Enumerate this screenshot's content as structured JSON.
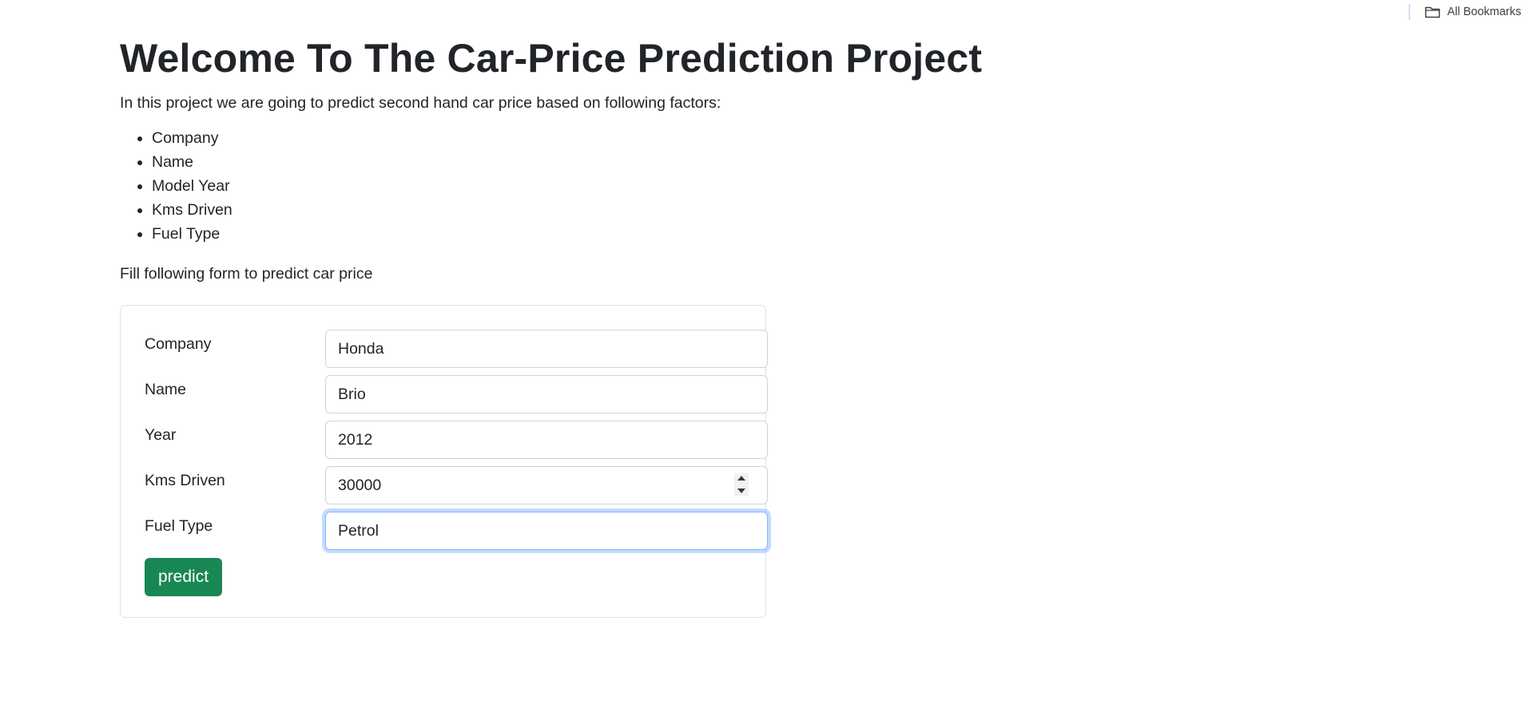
{
  "bookmarks": {
    "all_bookmarks_label": "All Bookmarks"
  },
  "page": {
    "title": "Welcome To The Car-Price Prediction Project",
    "intro": "In this project we are going to predict second hand car price based on following factors:",
    "factors": [
      "Company",
      "Name",
      "Model Year",
      "Kms Driven",
      "Fuel Type"
    ],
    "fill_note": "Fill following form to predict car price"
  },
  "form": {
    "company_label": "Company",
    "company_value": "Honda",
    "name_label": "Name",
    "name_value": "Brio",
    "year_label": "Year",
    "year_value": "2012",
    "kms_label": "Kms Driven",
    "kms_value": "30000",
    "fuel_label": "Fuel Type",
    "fuel_value": "Petrol",
    "predict_label": "predict"
  },
  "colors": {
    "button_green": "#198754",
    "focus_blue": "#86b7fe",
    "text": "#212529"
  },
  "icons": {
    "bookmark_folder": "folder-icon"
  }
}
